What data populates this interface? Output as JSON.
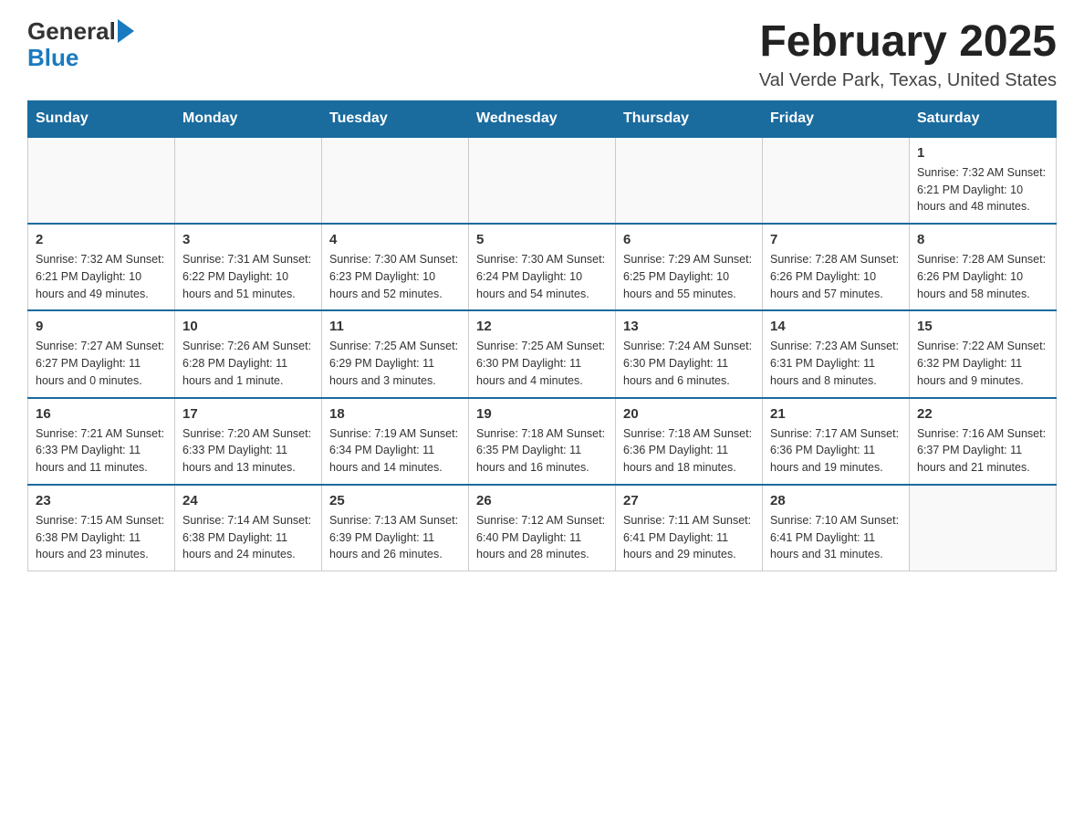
{
  "header": {
    "logo_general": "General",
    "logo_blue": "Blue",
    "title": "February 2025",
    "location": "Val Verde Park, Texas, United States"
  },
  "days_of_week": [
    "Sunday",
    "Monday",
    "Tuesday",
    "Wednesday",
    "Thursday",
    "Friday",
    "Saturday"
  ],
  "weeks": [
    [
      {
        "day": "",
        "info": ""
      },
      {
        "day": "",
        "info": ""
      },
      {
        "day": "",
        "info": ""
      },
      {
        "day": "",
        "info": ""
      },
      {
        "day": "",
        "info": ""
      },
      {
        "day": "",
        "info": ""
      },
      {
        "day": "1",
        "info": "Sunrise: 7:32 AM\nSunset: 6:21 PM\nDaylight: 10 hours\nand 48 minutes."
      }
    ],
    [
      {
        "day": "2",
        "info": "Sunrise: 7:32 AM\nSunset: 6:21 PM\nDaylight: 10 hours\nand 49 minutes."
      },
      {
        "day": "3",
        "info": "Sunrise: 7:31 AM\nSunset: 6:22 PM\nDaylight: 10 hours\nand 51 minutes."
      },
      {
        "day": "4",
        "info": "Sunrise: 7:30 AM\nSunset: 6:23 PM\nDaylight: 10 hours\nand 52 minutes."
      },
      {
        "day": "5",
        "info": "Sunrise: 7:30 AM\nSunset: 6:24 PM\nDaylight: 10 hours\nand 54 minutes."
      },
      {
        "day": "6",
        "info": "Sunrise: 7:29 AM\nSunset: 6:25 PM\nDaylight: 10 hours\nand 55 minutes."
      },
      {
        "day": "7",
        "info": "Sunrise: 7:28 AM\nSunset: 6:26 PM\nDaylight: 10 hours\nand 57 minutes."
      },
      {
        "day": "8",
        "info": "Sunrise: 7:28 AM\nSunset: 6:26 PM\nDaylight: 10 hours\nand 58 minutes."
      }
    ],
    [
      {
        "day": "9",
        "info": "Sunrise: 7:27 AM\nSunset: 6:27 PM\nDaylight: 11 hours\nand 0 minutes."
      },
      {
        "day": "10",
        "info": "Sunrise: 7:26 AM\nSunset: 6:28 PM\nDaylight: 11 hours\nand 1 minute."
      },
      {
        "day": "11",
        "info": "Sunrise: 7:25 AM\nSunset: 6:29 PM\nDaylight: 11 hours\nand 3 minutes."
      },
      {
        "day": "12",
        "info": "Sunrise: 7:25 AM\nSunset: 6:30 PM\nDaylight: 11 hours\nand 4 minutes."
      },
      {
        "day": "13",
        "info": "Sunrise: 7:24 AM\nSunset: 6:30 PM\nDaylight: 11 hours\nand 6 minutes."
      },
      {
        "day": "14",
        "info": "Sunrise: 7:23 AM\nSunset: 6:31 PM\nDaylight: 11 hours\nand 8 minutes."
      },
      {
        "day": "15",
        "info": "Sunrise: 7:22 AM\nSunset: 6:32 PM\nDaylight: 11 hours\nand 9 minutes."
      }
    ],
    [
      {
        "day": "16",
        "info": "Sunrise: 7:21 AM\nSunset: 6:33 PM\nDaylight: 11 hours\nand 11 minutes."
      },
      {
        "day": "17",
        "info": "Sunrise: 7:20 AM\nSunset: 6:33 PM\nDaylight: 11 hours\nand 13 minutes."
      },
      {
        "day": "18",
        "info": "Sunrise: 7:19 AM\nSunset: 6:34 PM\nDaylight: 11 hours\nand 14 minutes."
      },
      {
        "day": "19",
        "info": "Sunrise: 7:18 AM\nSunset: 6:35 PM\nDaylight: 11 hours\nand 16 minutes."
      },
      {
        "day": "20",
        "info": "Sunrise: 7:18 AM\nSunset: 6:36 PM\nDaylight: 11 hours\nand 18 minutes."
      },
      {
        "day": "21",
        "info": "Sunrise: 7:17 AM\nSunset: 6:36 PM\nDaylight: 11 hours\nand 19 minutes."
      },
      {
        "day": "22",
        "info": "Sunrise: 7:16 AM\nSunset: 6:37 PM\nDaylight: 11 hours\nand 21 minutes."
      }
    ],
    [
      {
        "day": "23",
        "info": "Sunrise: 7:15 AM\nSunset: 6:38 PM\nDaylight: 11 hours\nand 23 minutes."
      },
      {
        "day": "24",
        "info": "Sunrise: 7:14 AM\nSunset: 6:38 PM\nDaylight: 11 hours\nand 24 minutes."
      },
      {
        "day": "25",
        "info": "Sunrise: 7:13 AM\nSunset: 6:39 PM\nDaylight: 11 hours\nand 26 minutes."
      },
      {
        "day": "26",
        "info": "Sunrise: 7:12 AM\nSunset: 6:40 PM\nDaylight: 11 hours\nand 28 minutes."
      },
      {
        "day": "27",
        "info": "Sunrise: 7:11 AM\nSunset: 6:41 PM\nDaylight: 11 hours\nand 29 minutes."
      },
      {
        "day": "28",
        "info": "Sunrise: 7:10 AM\nSunset: 6:41 PM\nDaylight: 11 hours\nand 31 minutes."
      },
      {
        "day": "",
        "info": ""
      }
    ]
  ]
}
